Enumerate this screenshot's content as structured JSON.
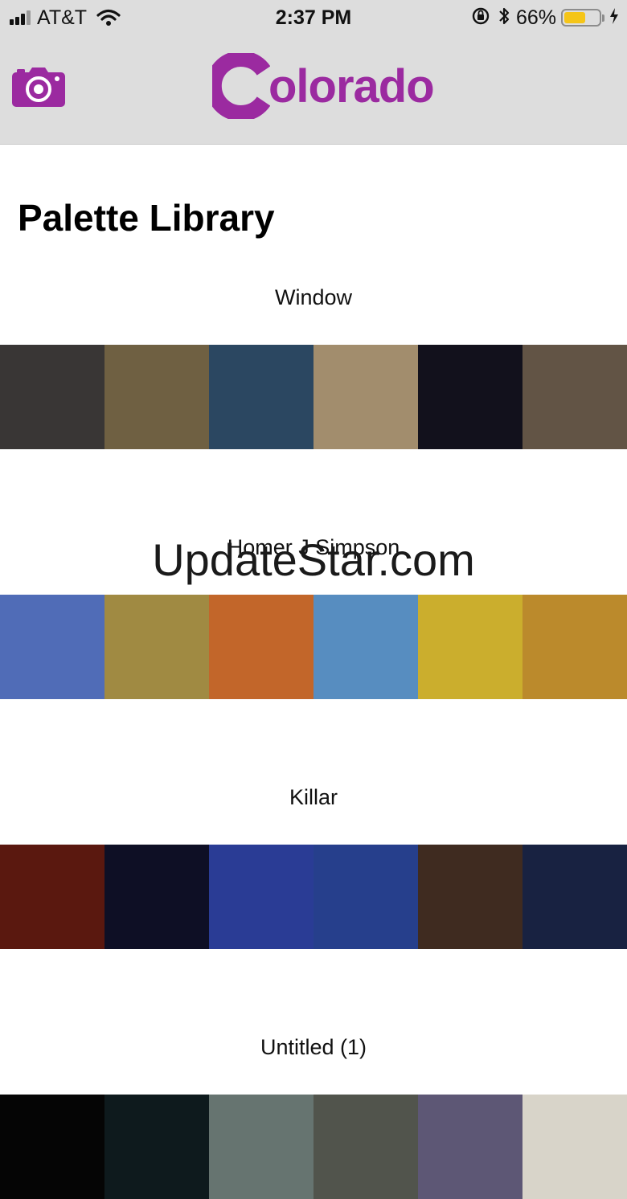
{
  "status_bar": {
    "carrier": "AT&T",
    "time": "2:37 PM",
    "battery_percent": "66%",
    "battery_level": 0.66,
    "icons": [
      "signal-icon",
      "wifi-icon",
      "orientation-lock-icon",
      "bluetooth-icon",
      "battery-icon",
      "charging-icon"
    ]
  },
  "nav": {
    "logo_text": "olorado",
    "camera_icon": "camera-icon",
    "accent_color": "#9b2aa0"
  },
  "page": {
    "title": "Palette Library"
  },
  "palettes": [
    {
      "name": "Window",
      "colors": [
        "#393635",
        "#6f6042",
        "#2b4761",
        "#a28d6d",
        "#12111c",
        "#625445"
      ]
    },
    {
      "name": "Homer J Simpson",
      "colors": [
        "#506cb7",
        "#a08a42",
        "#c2662a",
        "#578dc0",
        "#cbae2d",
        "#bb8a2c"
      ]
    },
    {
      "name": "Killar",
      "colors": [
        "#5a180f",
        "#0e0f25",
        "#2a3c95",
        "#263f8c",
        "#3f2b20",
        "#182241"
      ]
    },
    {
      "name": "Untitled (1)",
      "colors": [
        "#050505",
        "#0e1a1d",
        "#667470",
        "#51544c",
        "#5d5775",
        "#d8d4c9"
      ]
    }
  ],
  "watermark": {
    "text": "UpdateStar.com"
  }
}
